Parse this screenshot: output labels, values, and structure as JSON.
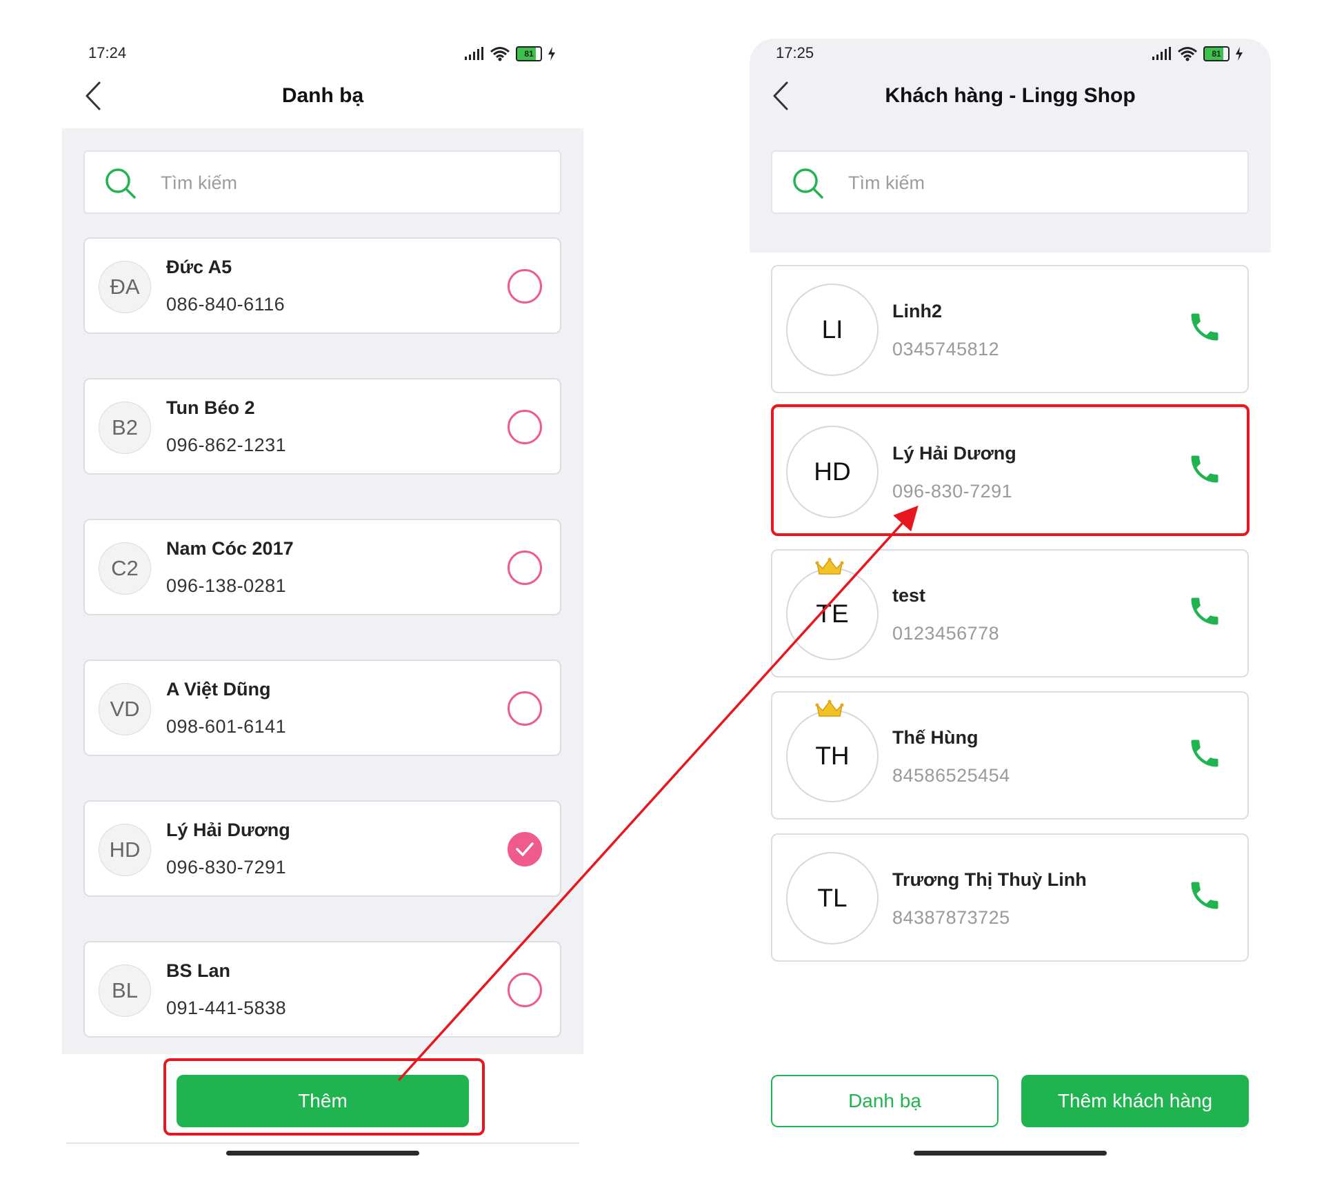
{
  "left_screen": {
    "status_bar": {
      "time": "17:24",
      "battery": "81"
    },
    "header": {
      "title": "Danh bạ"
    },
    "search": {
      "placeholder": "Tìm kiếm"
    },
    "contacts": [
      {
        "initials": "ĐA",
        "name": "Đức A5",
        "phone": "086-840-6116",
        "selected": false
      },
      {
        "initials": "B2",
        "name": "Tun Béo 2",
        "phone": "096-862-1231",
        "selected": false
      },
      {
        "initials": "C2",
        "name": "Nam Cóc 2017",
        "phone": "096-138-0281",
        "selected": false
      },
      {
        "initials": "VD",
        "name": "A Việt Dũng",
        "phone": "098-601-6141",
        "selected": false
      },
      {
        "initials": "HD",
        "name": "Lý Hải Dương",
        "phone": "096-830-7291",
        "selected": true
      },
      {
        "initials": "BL",
        "name": "BS Lan",
        "phone": "091-441-5838",
        "selected": false
      }
    ],
    "add_button": "Thêm"
  },
  "right_screen": {
    "status_bar": {
      "time": "17:25",
      "battery": "81"
    },
    "header": {
      "title": "Khách hàng - Lingg Shop"
    },
    "search": {
      "placeholder": "Tìm kiếm"
    },
    "customers": [
      {
        "initials": "LI",
        "name": "Linh2",
        "phone": "0345745812",
        "vip": false
      },
      {
        "initials": "HD",
        "name": "Lý Hải Dương",
        "phone": "096-830-7291",
        "vip": false
      },
      {
        "initials": "TE",
        "name": "test",
        "phone": "0123456778",
        "vip": true
      },
      {
        "initials": "TH",
        "name": "Thế Hùng",
        "phone": "84586525454",
        "vip": true
      },
      {
        "initials": "TL",
        "name": "Trương Thị Thuỳ Linh",
        "phone": "84387873725",
        "vip": false
      }
    ],
    "contacts_button": "Danh bạ",
    "add_customer_button": "Thêm khách hàng"
  },
  "colors": {
    "accent_green": "#20b450",
    "radio_pink": "#ef5b8e",
    "annotation_red": "#e8171f",
    "list_background": "#f0f1f5"
  },
  "icons": [
    "back-chevron-icon",
    "signal-icon",
    "wifi-icon",
    "battery-icon",
    "charging-icon",
    "search-icon",
    "phone-call-icon",
    "crown-icon",
    "check-icon"
  ]
}
